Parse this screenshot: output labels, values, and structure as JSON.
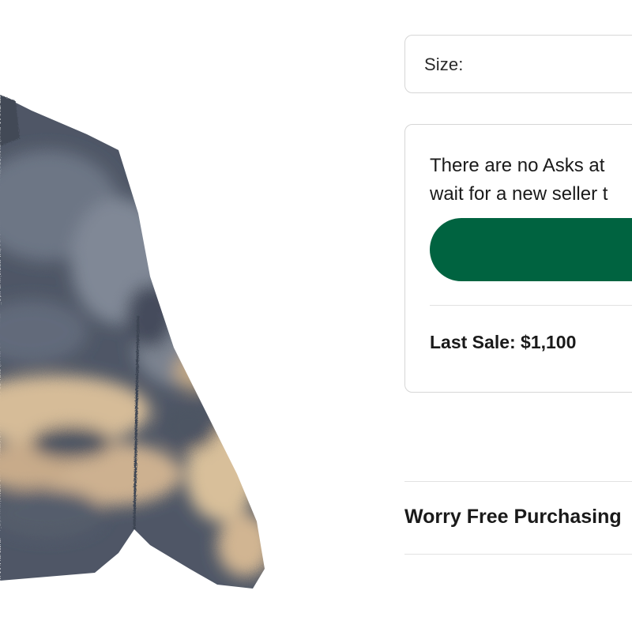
{
  "product": {
    "image_name": "tie-dye-fleece-sweater"
  },
  "size_selector": {
    "label": "Size:"
  },
  "ask_card": {
    "message_line1": "There are no Asks at",
    "message_line2": "wait for a new seller t",
    "button_color": "#006340",
    "last_sale": "Last Sale: $1,100"
  },
  "worry_free": {
    "label": "Worry Free Purchasing"
  }
}
